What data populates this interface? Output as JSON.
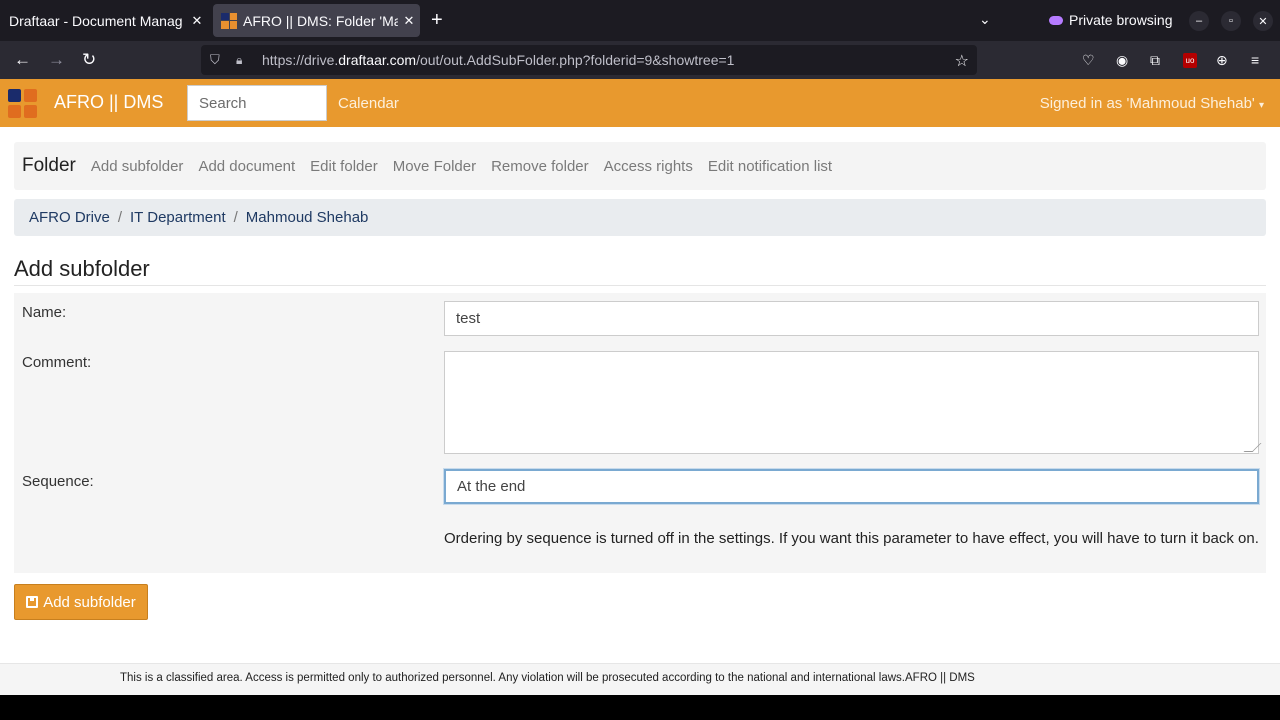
{
  "browser": {
    "tabs": [
      {
        "title": "Draftaar - Document Manag",
        "active": false
      },
      {
        "title": "AFRO || DMS: Folder 'Mal",
        "active": true
      }
    ],
    "private_label": "Private browsing",
    "url_prefix": "https://drive.",
    "url_host": "draftaar.com",
    "url_path": "/out/out.AddSubFolder.php?folderid=9&showtree=1"
  },
  "app": {
    "brand": "AFRO || DMS",
    "search_placeholder": "Search",
    "calendar": "Calendar",
    "signed_in": "Signed in as 'Mahmoud Shehab'",
    "accent": "#e8992e"
  },
  "subnav": {
    "head": "Folder",
    "links": [
      "Add subfolder",
      "Add document",
      "Edit folder",
      "Move Folder",
      "Remove folder",
      "Access rights",
      "Edit notification list"
    ]
  },
  "breadcrumb": [
    "AFRO Drive",
    "IT Department",
    "Mahmoud Shehab"
  ],
  "form": {
    "heading": "Add subfolder",
    "name_label": "Name:",
    "name_value": "test",
    "comment_label": "Comment:",
    "comment_value": "",
    "sequence_label": "Sequence:",
    "sequence_value": "At the end",
    "help": "Ordering by sequence is turned off in the settings. If you want this parameter to have effect, you will have to turn it back on.",
    "submit": "Add subfolder"
  },
  "footer": "This is a classified area. Access is permitted only to authorized personnel. Any violation will be prosecuted according to the national and international laws.AFRO || DMS"
}
